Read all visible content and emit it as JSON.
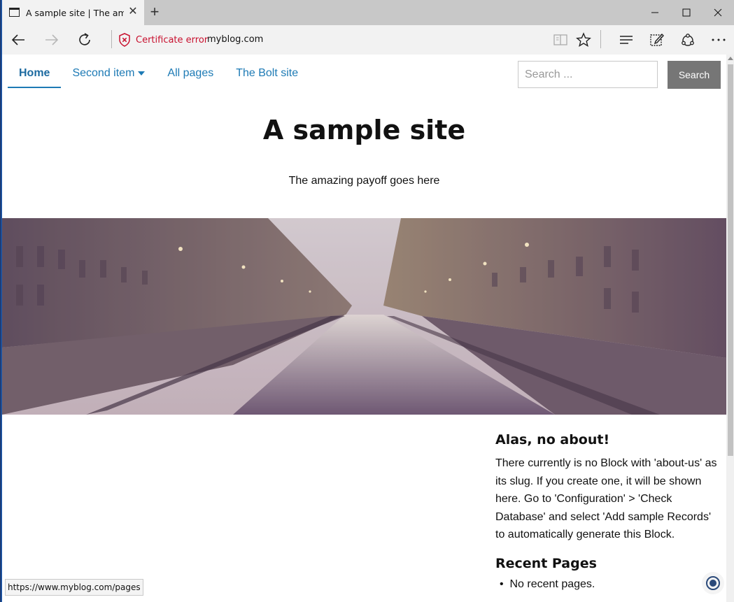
{
  "browser": {
    "tab_title": "A sample site | The ama",
    "security_label": "Certificate error",
    "url": "myblog.com",
    "status_url": "https://www.myblog.com/pages"
  },
  "nav": {
    "items": [
      {
        "label": "Home",
        "active": true
      },
      {
        "label": "Second item",
        "dropdown": true
      },
      {
        "label": "All pages"
      },
      {
        "label": "The Bolt site"
      }
    ],
    "search_placeholder": "Search ...",
    "search_button": "Search"
  },
  "header": {
    "title": "A sample site",
    "payoff": "The amazing payoff goes here"
  },
  "sidebar": {
    "about_heading": "Alas, no about!",
    "about_text": "There currently is no Block with 'about-us' as its slug. If you create one, it will be shown here. Go to 'Configuration' > 'Check Database' and select 'Add sample Records' to automatically generate this Block.",
    "recent_heading": "Recent Pages",
    "recent_items": [
      "No recent pages."
    ]
  },
  "colors": {
    "link": "#1d7ab5",
    "cert_error": "#c8102e",
    "search_button_bg": "#767676"
  }
}
